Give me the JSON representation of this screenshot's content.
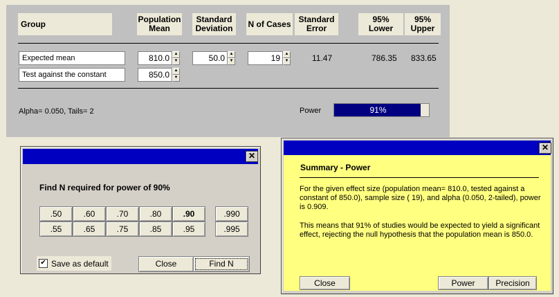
{
  "headers": {
    "group": "Group",
    "mean": "Population\nMean",
    "sd": "Standard\nDeviation",
    "n": "N of Cases",
    "se": "Standard\nError",
    "lower": "95%\nLower",
    "upper": "95%\nUpper"
  },
  "rows": {
    "expected_label": "Expected mean",
    "expected_mean": "810.0",
    "sd": "50.0",
    "n": "19",
    "se": "11.47",
    "lower": "786.35",
    "upper": "833.65",
    "constant_label": "Test against the constant",
    "constant_value": "850.0"
  },
  "alpha_text": "Alpha= 0.050, Tails= 2",
  "power": {
    "label": "Power",
    "value_text": "91%",
    "value": 0.91
  },
  "find_n_dialog": {
    "title": "",
    "heading": "Find N required for power of 90%",
    "row1": [
      ".50",
      ".60",
      ".70",
      ".80",
      ".90"
    ],
    "row2": [
      ".55",
      ".65",
      ".75",
      ".85",
      ".95"
    ],
    "extra": [
      ".990",
      ".995"
    ],
    "checkbox_label": "Save as default",
    "checkbox_checked": true,
    "close_label": "Close",
    "find_label": "Find N"
  },
  "summary_dialog": {
    "title": "Summary - Power",
    "para1": "For the given effect size (population mean=  810.0,  tested against a constant of  850.0),  sample size ( 19), and alpha (0.050, 2-tailed), power is 0.909.",
    "para2": "This means that 91% of studies would be expected to yield a significant effect, rejecting the null hypothesis that the population mean is  850.0.",
    "close_label": "Close",
    "power_label": "Power",
    "precision_label": "Precision"
  },
  "colors": {
    "titlebar": "#0000C0",
    "power_fill": "#000080",
    "summary_bg": "#FFFF80",
    "panel": "#C0C0C0"
  },
  "icons": [
    "close-icon",
    "spin-up-icon",
    "spin-down-icon",
    "checkbox-checked-icon"
  ]
}
